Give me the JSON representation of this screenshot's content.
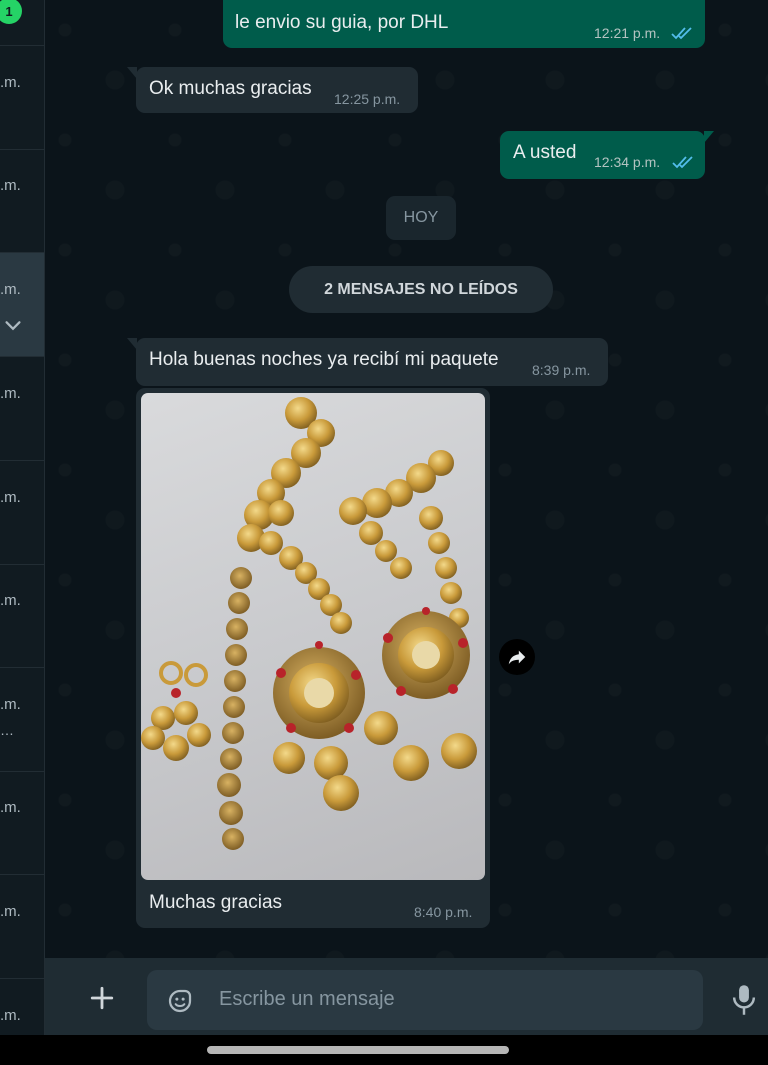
{
  "sidebar": {
    "unread_badge": "1",
    "times": [
      ".m.",
      ".m.",
      ".m.",
      ".m.",
      ".m.",
      ".m.",
      ".m.",
      ".m.",
      ".m.",
      ".m."
    ],
    "icons": [
      "chevron-down-icon",
      "ellipsis-icon"
    ]
  },
  "messages": [
    {
      "direction": "outgoing",
      "text": "le envio su guia, por DHL",
      "time": "12:21 p.m.",
      "status": "read"
    },
    {
      "direction": "incoming",
      "text": "Ok muchas gracias",
      "time": "12:25 p.m."
    },
    {
      "direction": "outgoing",
      "text": "A usted",
      "time": "12:34 p.m.",
      "status": "read"
    },
    {
      "direction": "incoming",
      "text": "Hola buenas noches ya recibí mi paquete",
      "time": "8:39 p.m."
    },
    {
      "direction": "incoming",
      "caption": "Muchas gracias",
      "time": "8:40 p.m.",
      "has_image": true
    }
  ],
  "date_divider": "HOY",
  "unread_divider": "2 MENSAJES NO LEÍDOS",
  "composer": {
    "placeholder": "Escribe un mensaje",
    "icons": [
      "plus-icon",
      "sticker-icon",
      "mic-icon"
    ]
  },
  "colors": {
    "outgoing_bubble": "#005c4b",
    "incoming_bubble": "#202c33",
    "background": "#0b141a",
    "read_ticks": "#53bdeb",
    "badge": "#25d366"
  }
}
